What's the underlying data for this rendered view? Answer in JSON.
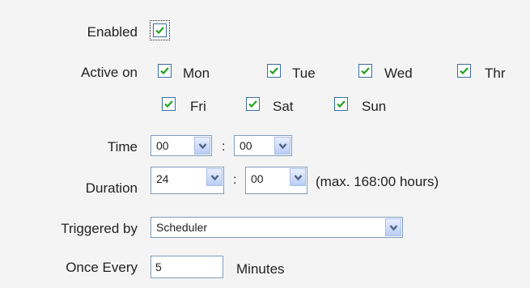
{
  "enabled": {
    "label": "Enabled",
    "checked": true
  },
  "active_on": {
    "label": "Active on",
    "days": [
      {
        "name": "Mon",
        "checked": true
      },
      {
        "name": "Tue",
        "checked": true
      },
      {
        "name": "Wed",
        "checked": true
      },
      {
        "name": "Thr",
        "checked": true
      },
      {
        "name": "Fri",
        "checked": true
      },
      {
        "name": "Sat",
        "checked": true
      },
      {
        "name": "Sun",
        "checked": true
      }
    ]
  },
  "time": {
    "label": "Time",
    "hours": "00",
    "separator": ":",
    "minutes": "00"
  },
  "duration": {
    "label": "Duration",
    "hours": "24",
    "separator": ":",
    "minutes": "00",
    "note": "(max. 168:00 hours)"
  },
  "triggered_by": {
    "label": "Triggered by",
    "value": "Scheduler"
  },
  "once_every": {
    "label": "Once Every",
    "value": "5",
    "unit": "Minutes"
  },
  "colors": {
    "checkbox_border": "#3a6ea5",
    "check_mark": "#21a121",
    "select_border": "#7f9db9",
    "arrow": "#4d6185"
  },
  "icons": {
    "check": "check-icon",
    "dropdown": "chevron-down-icon"
  }
}
